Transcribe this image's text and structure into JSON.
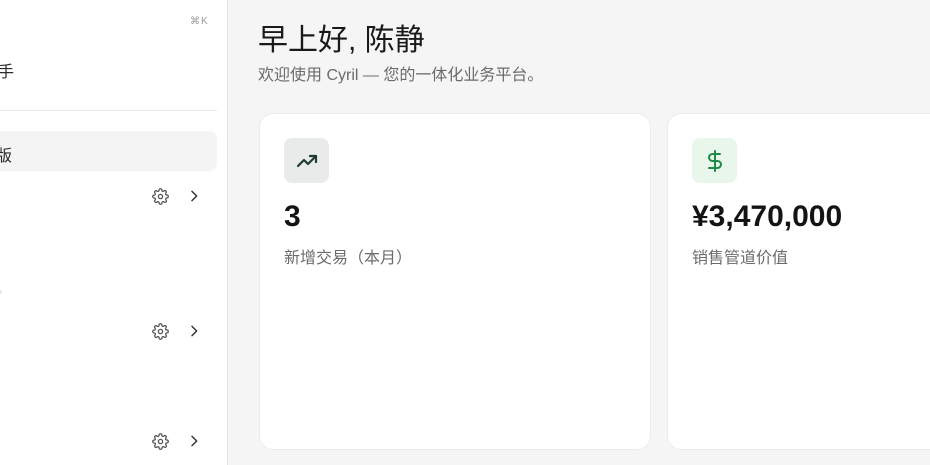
{
  "sidebar": {
    "shortcut_hint": "⌘K",
    "assistant_label": "手",
    "active_item_label": "版",
    "tiny_mark": "。"
  },
  "header": {
    "greeting": "早上好, 陈静",
    "subtitle": "欢迎使用 Cyril — 您的一体化业务平台。"
  },
  "cards": [
    {
      "icon": "trending-up-icon",
      "value": "3",
      "label": "新增交易（本月）"
    },
    {
      "icon": "dollar-icon",
      "value": "¥3,470,000",
      "label": "销售管道价值"
    }
  ],
  "colors": {
    "accent_green": "#1e8a47",
    "trend_icon": "#1f3b35",
    "background": "#f5f5f5"
  }
}
